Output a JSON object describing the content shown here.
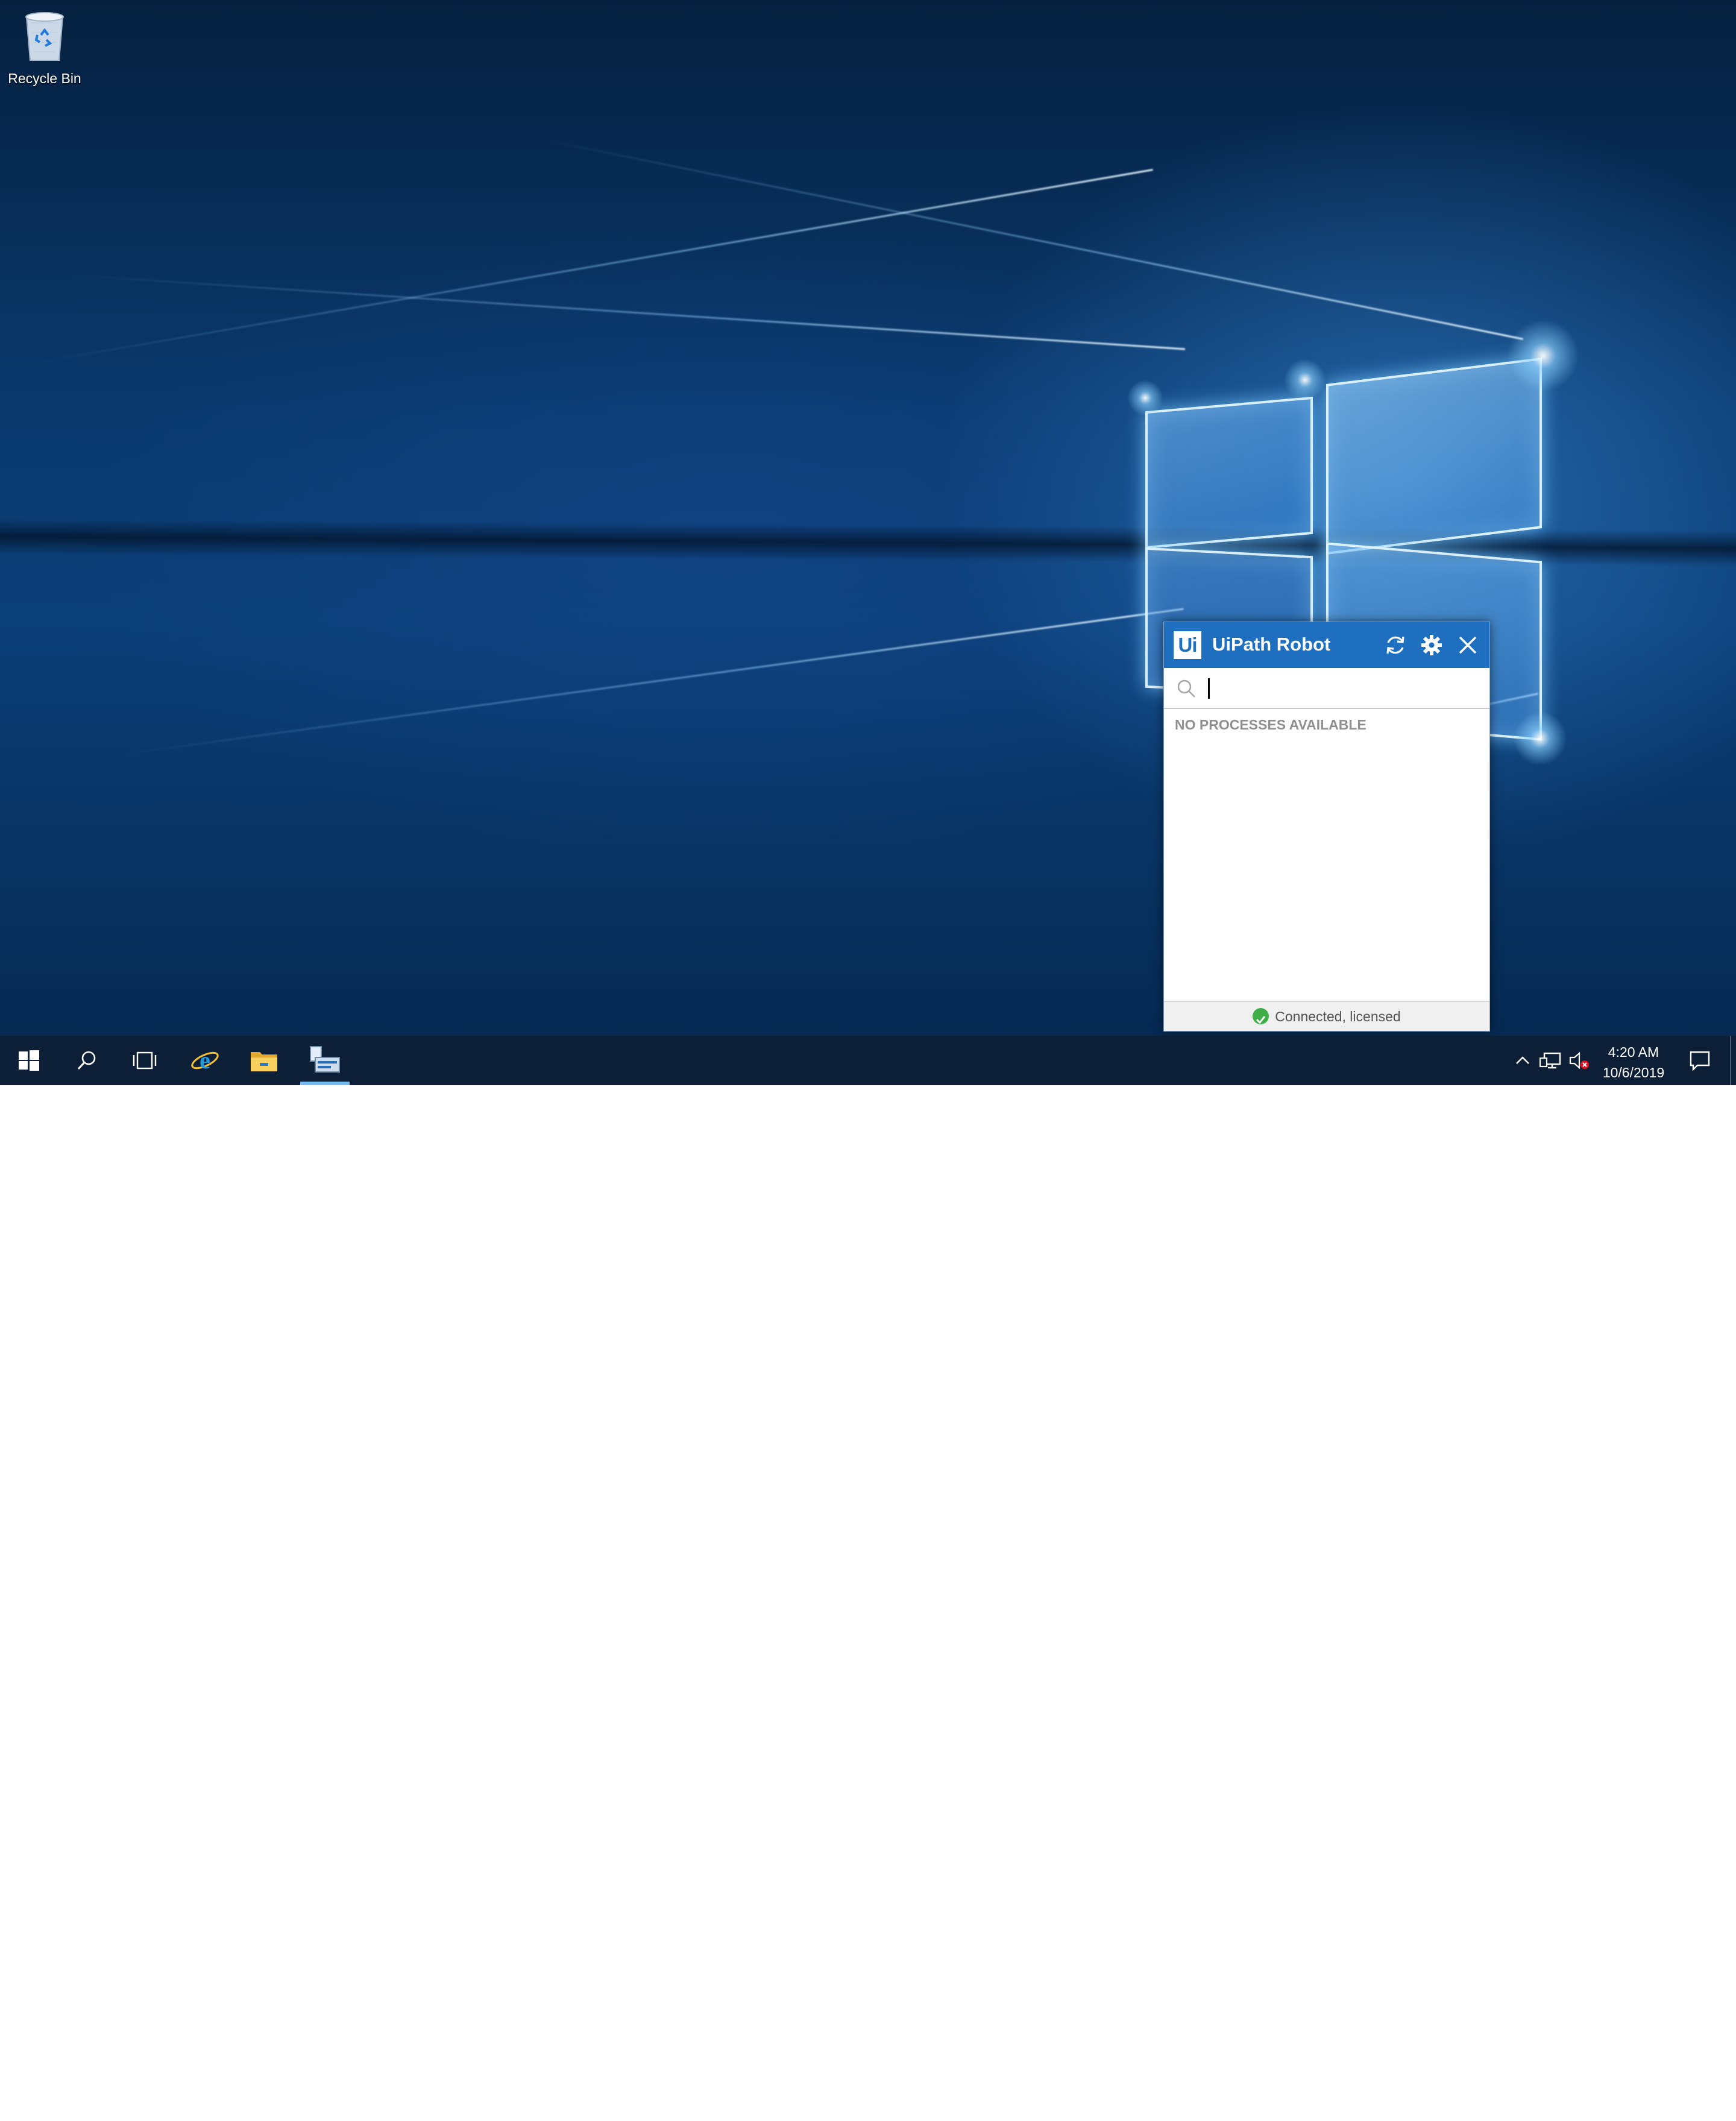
{
  "desktop": {
    "icons": [
      {
        "label": "Recycle Bin",
        "icon": "recycle-bin-icon"
      }
    ]
  },
  "uipath_window": {
    "logo_text": "Ui",
    "title": "UiPath Robot",
    "search": {
      "placeholder": "",
      "value": ""
    },
    "empty_message": "NO PROCESSES AVAILABLE",
    "status": "Connected, licensed",
    "colors": {
      "header": "#1f6fc1",
      "status_ok": "#3fae49"
    }
  },
  "taskbar": {
    "apps": [
      "start-icon",
      "search-icon",
      "task-view-icon",
      "internet-explorer-icon",
      "file-explorer-icon",
      "uipath-robot-icon"
    ],
    "active_app": "uipath-robot-icon",
    "tray_icons": [
      "show-hidden-icons-chevron",
      "network-icon",
      "volume-muted-icon"
    ],
    "clock": {
      "time": "4:20 AM",
      "date": "10/6/2019"
    },
    "notification_icon": "action-center-icon"
  }
}
